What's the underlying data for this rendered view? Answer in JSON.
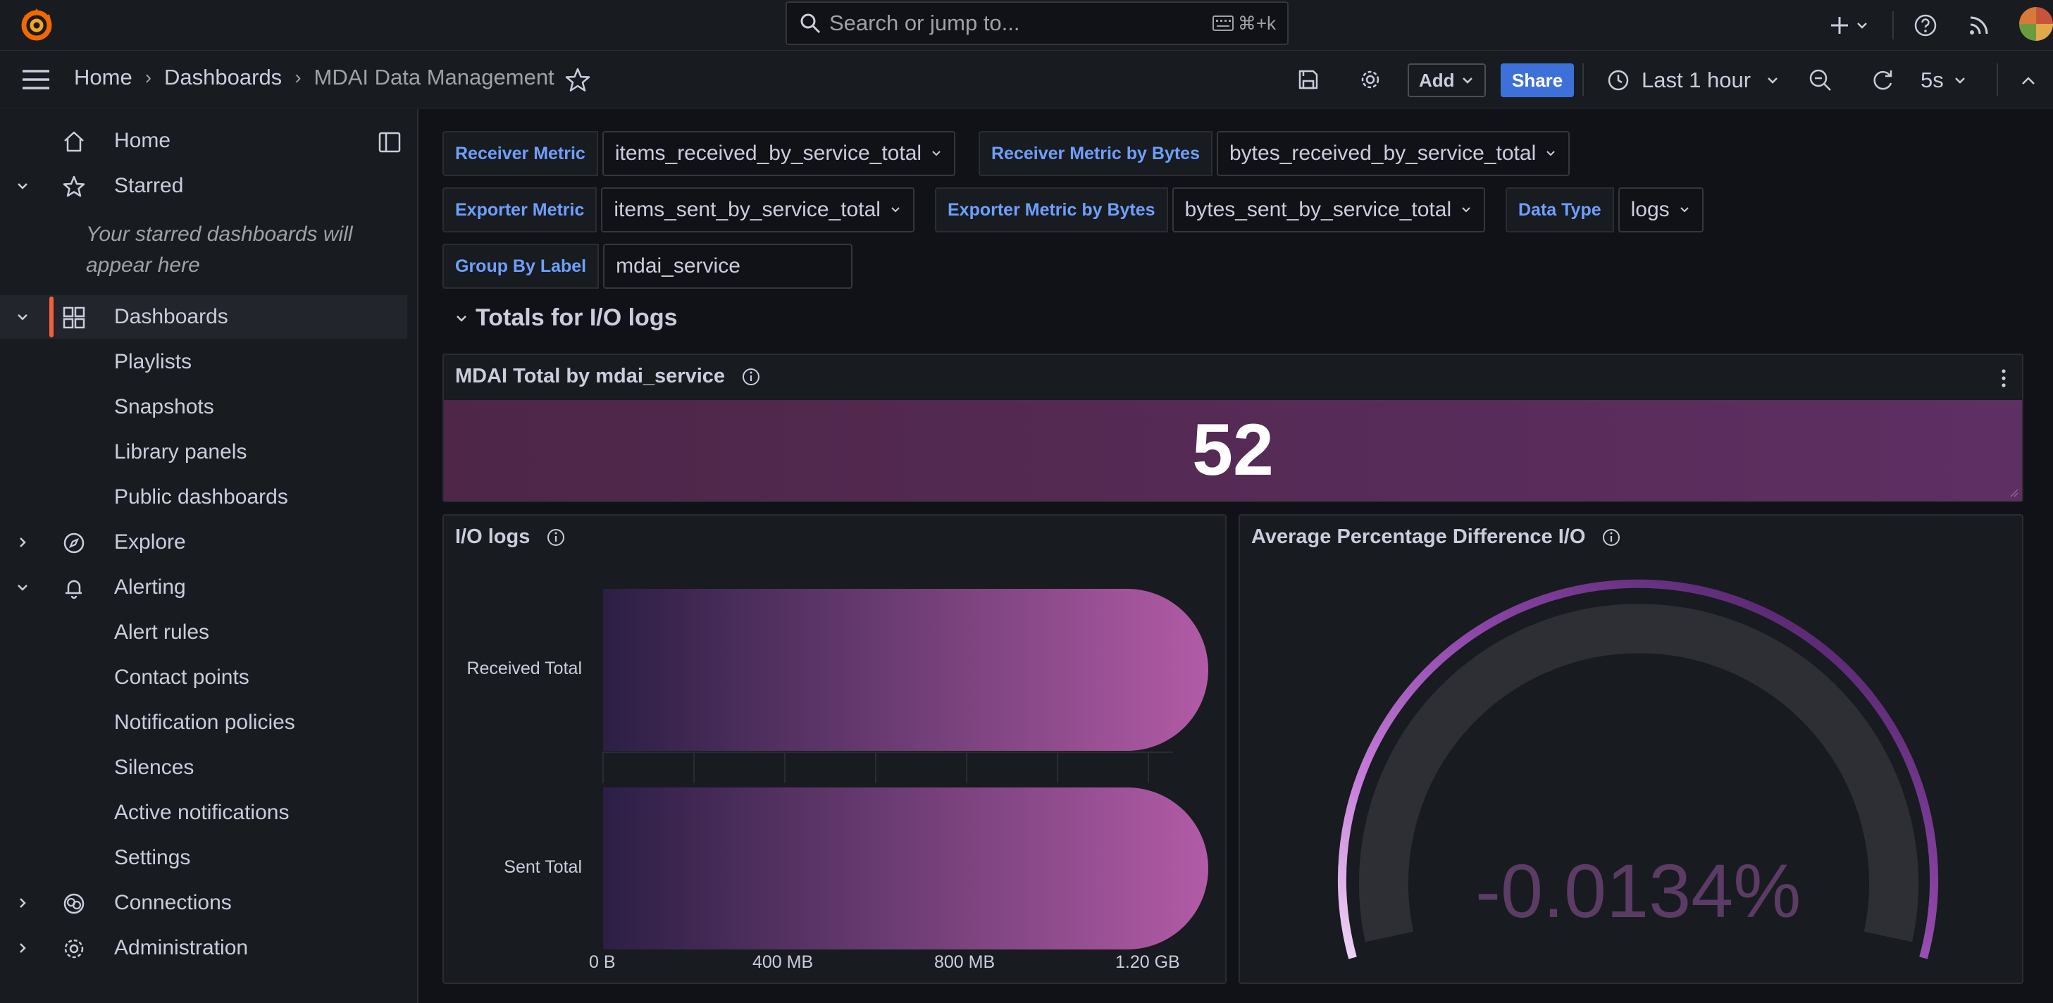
{
  "topbar": {
    "search_placeholder": "Search or jump to...",
    "search_shortcut": "⌘+k",
    "icons": [
      "grafana-logo-icon",
      "search-icon",
      "keyboard-icon",
      "plus-icon",
      "chevron-down-icon",
      "help-icon",
      "news-rss-icon",
      "avatar"
    ]
  },
  "navbar": {
    "breadcrumbs": [
      "Home",
      "Dashboards",
      "MDAI Data Management"
    ],
    "add_label": "Add",
    "share_label": "Share",
    "time_range": "Last 1 hour",
    "refresh_interval": "5s"
  },
  "sidebar": {
    "items": [
      {
        "label": "Home",
        "icon": "home-icon"
      },
      {
        "label": "Starred",
        "icon": "star-icon",
        "expanded": true
      },
      {
        "label": "Dashboards",
        "icon": "apps-icon",
        "expanded": true,
        "active": true
      },
      {
        "label": "Playlists"
      },
      {
        "label": "Snapshots"
      },
      {
        "label": "Library panels"
      },
      {
        "label": "Public dashboards"
      },
      {
        "label": "Explore",
        "icon": "compass-icon"
      },
      {
        "label": "Alerting",
        "icon": "bell-icon",
        "expanded": true
      },
      {
        "label": "Alert rules"
      },
      {
        "label": "Contact points"
      },
      {
        "label": "Notification policies"
      },
      {
        "label": "Silences"
      },
      {
        "label": "Active notifications"
      },
      {
        "label": "Settings"
      },
      {
        "label": "Connections",
        "icon": "connections-icon"
      },
      {
        "label": "Administration",
        "icon": "gear-icon"
      }
    ],
    "starred_note_line1": "Your starred dashboards will",
    "starred_note_line2": "appear here"
  },
  "variables": [
    {
      "label": "Receiver Metric",
      "value": "items_received_by_service_total"
    },
    {
      "label": "Receiver Metric by Bytes",
      "value": "bytes_received_by_service_total"
    },
    {
      "label": "Exporter Metric",
      "value": "items_sent_by_service_total"
    },
    {
      "label": "Exporter Metric by Bytes",
      "value": "bytes_sent_by_service_total"
    },
    {
      "label": "Data Type",
      "value": "logs"
    },
    {
      "label": "Group By Label",
      "value": "mdai_service"
    }
  ],
  "row": {
    "title": "Totals for I/O logs"
  },
  "panels": {
    "stat": {
      "title": "MDAI Total by mdai_service",
      "value": "52",
      "color": "#5e2f63"
    },
    "bars": {
      "title": "I/O logs"
    },
    "gauge": {
      "title": "Average Percentage Difference I/O",
      "value": "-0.0134",
      "unit": "%"
    }
  },
  "chart_data": {
    "type": "bar",
    "orientation": "horizontal",
    "categories": [
      "Received Total",
      "Sent Total"
    ],
    "values": [
      1.3,
      1.3
    ],
    "unit": "GB",
    "x_ticks": [
      "0 B",
      "400 MB",
      "800 MB",
      "1.20 GB"
    ],
    "xlim": [
      0,
      1.3
    ],
    "colors": [
      "#2b1f44",
      "#b25ba6"
    ]
  },
  "colors": {
    "accent_orange": "#f55f3e",
    "primary_blue": "#3d71d9",
    "variable_label": "#6e9fff",
    "stat_purple": "#5e2f63"
  }
}
